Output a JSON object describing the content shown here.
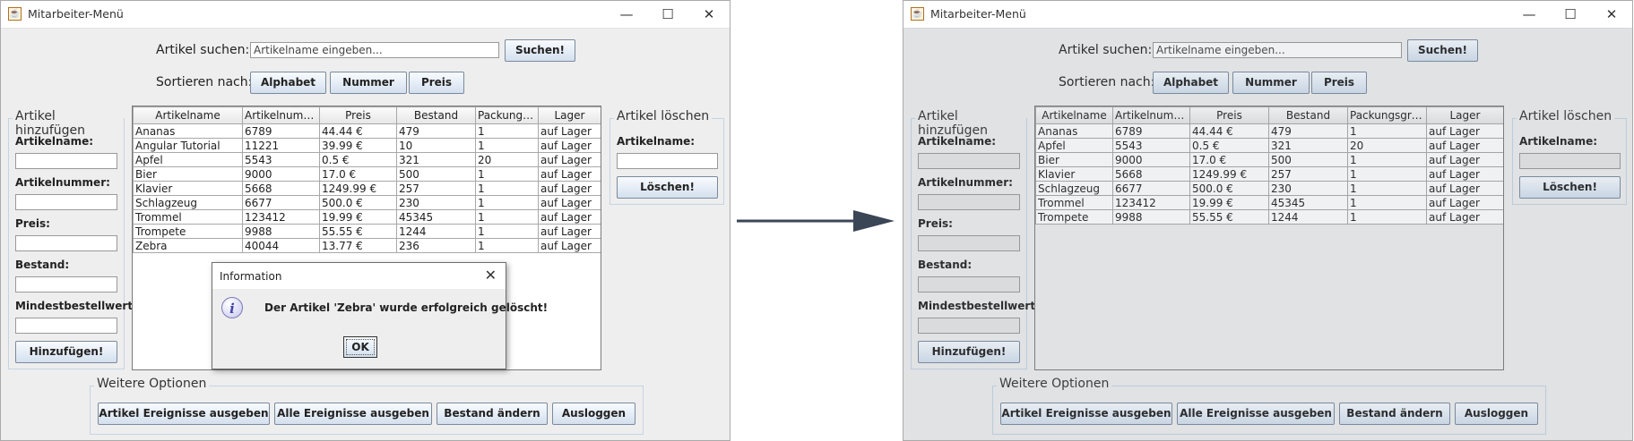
{
  "window": {
    "title": "Mitarbeiter-Menü",
    "minimize": "—",
    "maximize": "☐",
    "close": "✕"
  },
  "search": {
    "label": "Artikel suchen:",
    "placeholder": "Artikelname eingeben...",
    "button": "Suchen!"
  },
  "sort": {
    "label": "Sortieren nach:",
    "buttons": [
      "Alphabet",
      "Nummer",
      "Preis"
    ]
  },
  "add_panel": {
    "title": "Artikel hinzufügen",
    "fields": [
      "Artikelname:",
      "Artikelnummer:",
      "Preis:",
      "Bestand:",
      "Mindestbestellwert:"
    ],
    "button": "Hinzufügen!"
  },
  "delete_panel": {
    "title": "Artikel löschen",
    "field": "Artikelname:",
    "button": "Löschen!"
  },
  "options_panel": {
    "title": "Weitere Optionen",
    "buttons": [
      "Artikel Ereignisse ausgeben",
      "Alle Ereignisse ausgeben",
      "Bestand ändern",
      "Ausloggen"
    ]
  },
  "table_before": {
    "columns": [
      "Artikelname",
      "Artikelnummer",
      "Preis",
      "Bestand",
      "Packungs...",
      "Lager"
    ],
    "rows": [
      [
        "Ananas",
        "6789",
        "44.44 €",
        "479",
        "1",
        "auf Lager"
      ],
      [
        "Angular Tutorial",
        "11221",
        "39.99 €",
        "10",
        "1",
        "auf Lager"
      ],
      [
        "Apfel",
        "5543",
        "0.5 €",
        "321",
        "20",
        "auf Lager"
      ],
      [
        "Bier",
        "9000",
        "17.0 €",
        "500",
        "1",
        "auf Lager"
      ],
      [
        "Klavier",
        "5668",
        "1249.99 €",
        "257",
        "1",
        "auf Lager"
      ],
      [
        "Schlagzeug",
        "6677",
        "500.0 €",
        "230",
        "1",
        "auf Lager"
      ],
      [
        "Trommel",
        "123412",
        "19.99 €",
        "45345",
        "1",
        "auf Lager"
      ],
      [
        "Trompete",
        "9988",
        "55.55 €",
        "1244",
        "1",
        "auf Lager"
      ],
      [
        "Zebra",
        "40044",
        "13.77 €",
        "236",
        "1",
        "auf Lager"
      ]
    ]
  },
  "table_after": {
    "columns": [
      "Artikelname",
      "Artikelnummer",
      "Preis",
      "Bestand",
      "Packungsgrö...",
      "Lager"
    ],
    "rows": [
      [
        "Ananas",
        "6789",
        "44.44 €",
        "479",
        "1",
        "auf Lager"
      ],
      [
        "Apfel",
        "5543",
        "0.5 €",
        "321",
        "20",
        "auf Lager"
      ],
      [
        "Bier",
        "9000",
        "17.0 €",
        "500",
        "1",
        "auf Lager"
      ],
      [
        "Klavier",
        "5668",
        "1249.99 €",
        "257",
        "1",
        "auf Lager"
      ],
      [
        "Schlagzeug",
        "6677",
        "500.0 €",
        "230",
        "1",
        "auf Lager"
      ],
      [
        "Trommel",
        "123412",
        "19.99 €",
        "45345",
        "1",
        "auf Lager"
      ],
      [
        "Trompete",
        "9988",
        "55.55 €",
        "1244",
        "1",
        "auf Lager"
      ]
    ]
  },
  "dialog": {
    "title": "Information",
    "message": "Der Artikel 'Zebra' wurde erfolgreich gelöscht!",
    "ok": "OK",
    "close": "✕",
    "icon": "i"
  },
  "app_icon": "☕",
  "colors": {
    "window_bg": "#eeeeee",
    "arrow": "#3a4556",
    "button_border": "#7a8a9c"
  }
}
